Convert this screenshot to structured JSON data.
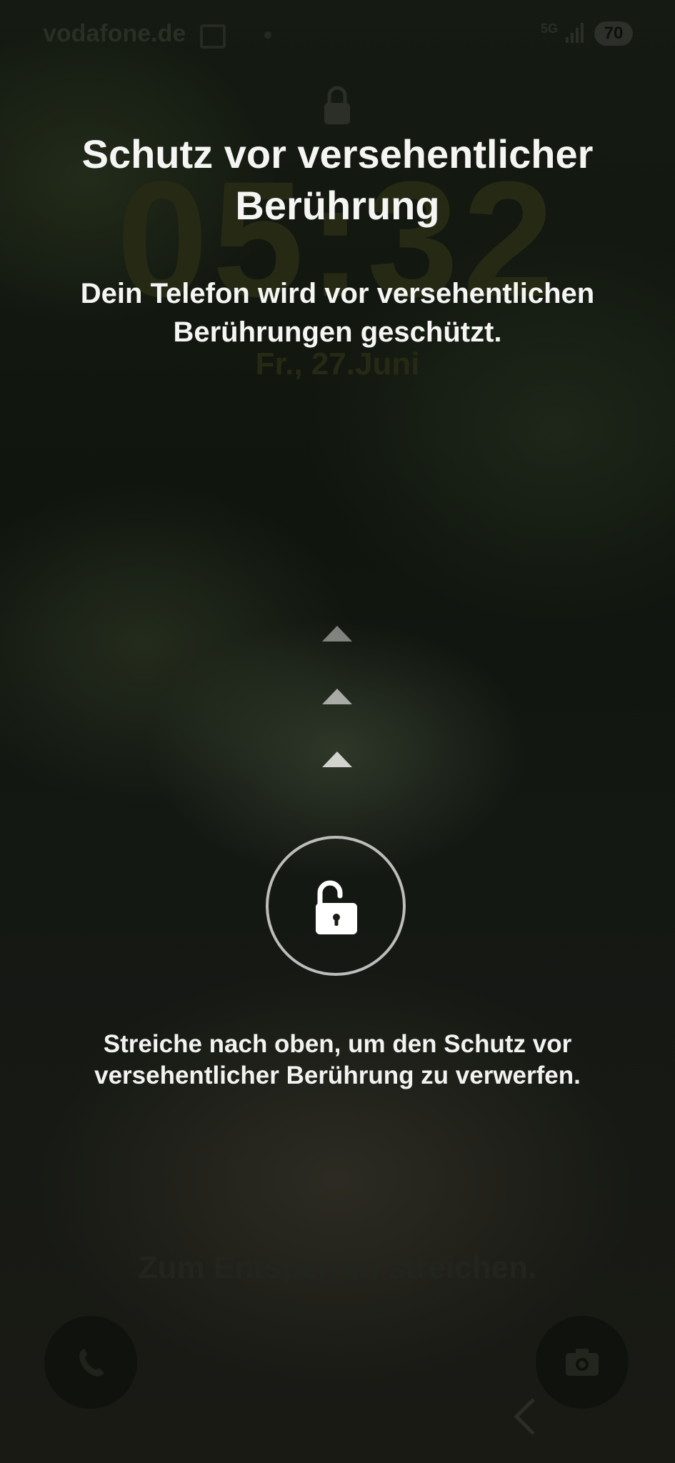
{
  "status_bar": {
    "carrier": "vodafone.de",
    "network": "5G",
    "battery": "70"
  },
  "lock_screen": {
    "time": "05:32",
    "date": "Fr., 27.Juni",
    "unlock_hint": "Zum Entsperren streichen.",
    "left_shortcut_icon": "phone-icon",
    "right_shortcut_icon": "camera-icon"
  },
  "protection": {
    "title": "Schutz vor versehentlicher Berührung",
    "subtitle": "Dein Telefon wird vor versehentlichen Berührungen geschützt.",
    "swipe_icon": "chevron-up-icon",
    "unlock_icon": "open-padlock-icon",
    "instruction": "Streiche nach oben, um den Schutz vor versehentlicher Berührung zu verwerfen."
  },
  "navigation": {
    "back_icon": "back-chevron-icon"
  }
}
